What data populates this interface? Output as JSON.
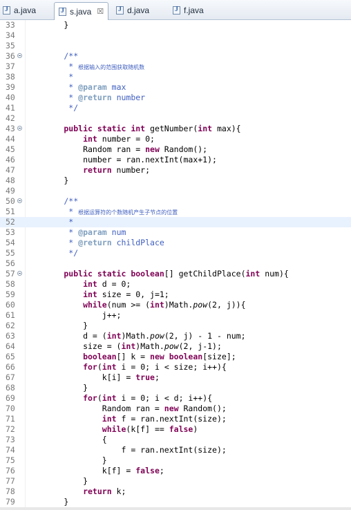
{
  "tabs": [
    {
      "name": "a.java",
      "active": false
    },
    {
      "name": "s.java",
      "active": true,
      "close": "☒"
    },
    {
      "name": "d.java",
      "active": false
    },
    {
      "name": "f.java",
      "active": false
    }
  ],
  "current_line": 52,
  "lines": [
    {
      "n": 33,
      "seg": [
        [
          "",
          "        }"
        ]
      ]
    },
    {
      "n": 34,
      "seg": []
    },
    {
      "n": 35,
      "seg": []
    },
    {
      "n": 36,
      "fold": true,
      "seg": [
        [
          "cm",
          "        /**"
        ]
      ]
    },
    {
      "n": 37,
      "seg": [
        [
          "cm",
          "         * "
        ],
        [
          "cjk",
          "根据输入的范围获取随机数"
        ]
      ]
    },
    {
      "n": 38,
      "seg": [
        [
          "cm",
          "         *"
        ]
      ]
    },
    {
      "n": 39,
      "seg": [
        [
          "cm",
          "         * "
        ],
        [
          "ann",
          "@param"
        ],
        [
          "cm",
          " max"
        ]
      ]
    },
    {
      "n": 40,
      "seg": [
        [
          "cm",
          "         * "
        ],
        [
          "ann",
          "@return"
        ],
        [
          "cm",
          " number"
        ]
      ]
    },
    {
      "n": 41,
      "seg": [
        [
          "cm",
          "         */"
        ]
      ]
    },
    {
      "n": 42,
      "seg": []
    },
    {
      "n": 43,
      "fold": true,
      "seg": [
        [
          "kw",
          "        public static int"
        ],
        [
          "",
          " getNumber("
        ],
        [
          "kw",
          "int"
        ],
        [
          "",
          " max){"
        ]
      ]
    },
    {
      "n": 44,
      "seg": [
        [
          "kw",
          "            int"
        ],
        [
          "",
          " number = 0;"
        ]
      ]
    },
    {
      "n": 45,
      "seg": [
        [
          "",
          "            Random ran = "
        ],
        [
          "kw",
          "new"
        ],
        [
          "",
          " Random();"
        ]
      ]
    },
    {
      "n": 46,
      "seg": [
        [
          "",
          "            number = ran.nextInt(max+1);"
        ]
      ]
    },
    {
      "n": 47,
      "seg": [
        [
          "kw",
          "            return"
        ],
        [
          "",
          " number;"
        ]
      ]
    },
    {
      "n": 48,
      "seg": [
        [
          "",
          "        }"
        ]
      ]
    },
    {
      "n": 49,
      "seg": []
    },
    {
      "n": 50,
      "fold": true,
      "seg": [
        [
          "cm",
          "        /**"
        ]
      ]
    },
    {
      "n": 51,
      "seg": [
        [
          "cm",
          "         * "
        ],
        [
          "cjk",
          "根据运算符的个数随机产生子节点的位置"
        ]
      ]
    },
    {
      "n": 52,
      "seg": [
        [
          "cm",
          "         *"
        ]
      ]
    },
    {
      "n": 53,
      "seg": [
        [
          "cm",
          "         * "
        ],
        [
          "ann",
          "@param"
        ],
        [
          "cm",
          " num"
        ]
      ]
    },
    {
      "n": 54,
      "seg": [
        [
          "cm",
          "         * "
        ],
        [
          "ann",
          "@return"
        ],
        [
          "cm",
          " childPlace"
        ]
      ]
    },
    {
      "n": 55,
      "seg": [
        [
          "cm",
          "         */"
        ]
      ]
    },
    {
      "n": 56,
      "seg": []
    },
    {
      "n": 57,
      "fold": true,
      "seg": [
        [
          "kw",
          "        public static boolean"
        ],
        [
          "",
          "[] getChildPlace("
        ],
        [
          "kw",
          "int"
        ],
        [
          "",
          " num){"
        ]
      ]
    },
    {
      "n": 58,
      "seg": [
        [
          "kw",
          "            int"
        ],
        [
          "",
          " d = 0;"
        ]
      ]
    },
    {
      "n": 59,
      "seg": [
        [
          "kw",
          "            int"
        ],
        [
          "",
          " size = 0, j=1;"
        ]
      ]
    },
    {
      "n": 60,
      "seg": [
        [
          "kw",
          "            while"
        ],
        [
          "",
          "(num >= ("
        ],
        [
          "kw",
          "int"
        ],
        [
          "",
          ")Math."
        ],
        [
          "it",
          "pow"
        ],
        [
          "",
          "(2, j)){"
        ]
      ]
    },
    {
      "n": 61,
      "seg": [
        [
          "",
          "                j++;"
        ]
      ]
    },
    {
      "n": 62,
      "seg": [
        [
          "",
          "            }"
        ]
      ]
    },
    {
      "n": 63,
      "seg": [
        [
          "",
          "            d = ("
        ],
        [
          "kw",
          "int"
        ],
        [
          "",
          ")Math."
        ],
        [
          "it",
          "pow"
        ],
        [
          "",
          "(2, j) - 1 - num;"
        ]
      ]
    },
    {
      "n": 64,
      "seg": [
        [
          "",
          "            size = ("
        ],
        [
          "kw",
          "int"
        ],
        [
          "",
          ")Math."
        ],
        [
          "it",
          "pow"
        ],
        [
          "",
          "(2, j-1);"
        ]
      ]
    },
    {
      "n": 65,
      "seg": [
        [
          "kw",
          "            boolean"
        ],
        [
          "",
          "[] k = "
        ],
        [
          "kw",
          "new boolean"
        ],
        [
          "",
          "[size];"
        ]
      ]
    },
    {
      "n": 66,
      "seg": [
        [
          "kw",
          "            for"
        ],
        [
          "",
          "("
        ],
        [
          "kw",
          "int"
        ],
        [
          "",
          " i = 0; i < size; i++){"
        ]
      ]
    },
    {
      "n": 67,
      "seg": [
        [
          "",
          "                k[i] = "
        ],
        [
          "kw",
          "true"
        ],
        [
          "",
          ";"
        ]
      ]
    },
    {
      "n": 68,
      "seg": [
        [
          "",
          "            }"
        ]
      ]
    },
    {
      "n": 69,
      "seg": [
        [
          "kw",
          "            for"
        ],
        [
          "",
          "("
        ],
        [
          "kw",
          "int"
        ],
        [
          "",
          " i = 0; i < d; i++){"
        ]
      ]
    },
    {
      "n": 70,
      "seg": [
        [
          "",
          "                Random ran = "
        ],
        [
          "kw",
          "new"
        ],
        [
          "",
          " Random();"
        ]
      ]
    },
    {
      "n": 71,
      "seg": [
        [
          "kw",
          "                int"
        ],
        [
          "",
          " f = ran.nextInt(size);"
        ]
      ]
    },
    {
      "n": 72,
      "seg": [
        [
          "kw",
          "                while"
        ],
        [
          "",
          "(k[f] == "
        ],
        [
          "kw",
          "false"
        ],
        [
          "",
          ")"
        ]
      ]
    },
    {
      "n": 73,
      "seg": [
        [
          "",
          "                {"
        ]
      ]
    },
    {
      "n": 74,
      "seg": [
        [
          "",
          "                    f = ran.nextInt(size);"
        ]
      ]
    },
    {
      "n": 75,
      "seg": [
        [
          "",
          "                }"
        ]
      ]
    },
    {
      "n": 76,
      "seg": [
        [
          "",
          "                k[f] = "
        ],
        [
          "kw",
          "false"
        ],
        [
          "",
          ";"
        ]
      ]
    },
    {
      "n": 77,
      "seg": [
        [
          "",
          "            }"
        ]
      ]
    },
    {
      "n": 78,
      "seg": [
        [
          "kw",
          "            return"
        ],
        [
          "",
          " k;"
        ]
      ]
    },
    {
      "n": 79,
      "seg": [
        [
          "",
          "        }"
        ]
      ]
    }
  ]
}
